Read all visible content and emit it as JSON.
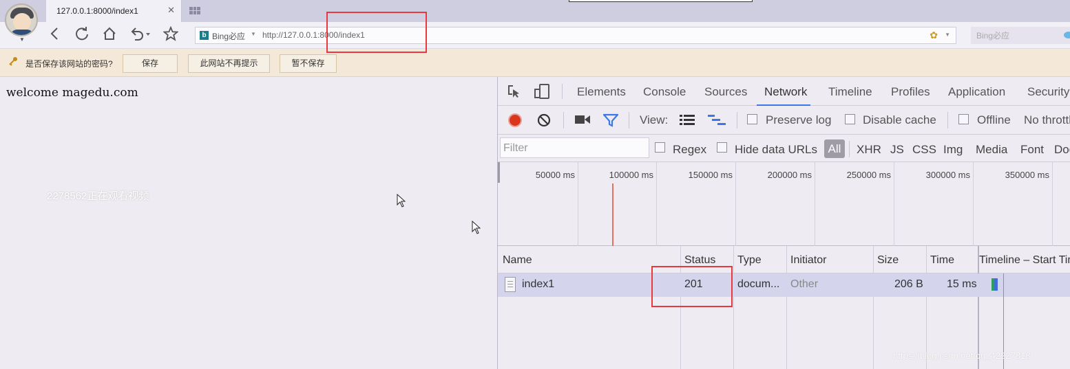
{
  "tab": {
    "title": "127.0.0.1:8000/index1",
    "close": "✕"
  },
  "address_bar": {
    "engine": "Bing必应",
    "url": "http://127.0.0.1:8000/index1",
    "search_placeholder": "Bing必应"
  },
  "password_bar": {
    "prompt": "是否保存该网站的密码?",
    "save": "保存",
    "never": "此网站不再提示",
    "not_now": "暂不保存"
  },
  "page": {
    "welcome": "welcome magedu.com",
    "watermark": "2278562正在观看视频"
  },
  "devtools": {
    "tabs": [
      "Elements",
      "Console",
      "Sources",
      "Network",
      "Timeline",
      "Profiles",
      "Application",
      "Security"
    ],
    "active_tab": "Network",
    "toolbar": {
      "view_label": "View:",
      "preserve_log": "Preserve log",
      "disable_cache": "Disable cache",
      "offline": "Offline",
      "throttle": "No throttling"
    },
    "filter": {
      "placeholder": "Filter",
      "regex": "Regex",
      "hide_data_urls": "Hide data URLs",
      "types": [
        "All",
        "XHR",
        "JS",
        "CSS",
        "Img",
        "Media",
        "Font",
        "Doc"
      ]
    },
    "overview_ticks": [
      "50000 ms",
      "100000 ms",
      "150000 ms",
      "200000 ms",
      "250000 ms",
      "300000 ms",
      "350000 ms"
    ],
    "columns": {
      "name": "Name",
      "status": "Status",
      "type": "Type",
      "initiator": "Initiator",
      "size": "Size",
      "time": "Time",
      "timeline": "Timeline – Start Time"
    },
    "rows": [
      {
        "name": "index1",
        "status": "201",
        "type": "docum...",
        "initiator": "Other",
        "size": "206 B",
        "time": "15 ms"
      }
    ]
  },
  "credit": "https://blog.csdn.net/qq_42227818",
  "colors": {
    "record": "#d8361d",
    "active_tab_underline": "#3b78e7",
    "highlight": "#e8373d",
    "selected_row": "#d4d4ed"
  }
}
